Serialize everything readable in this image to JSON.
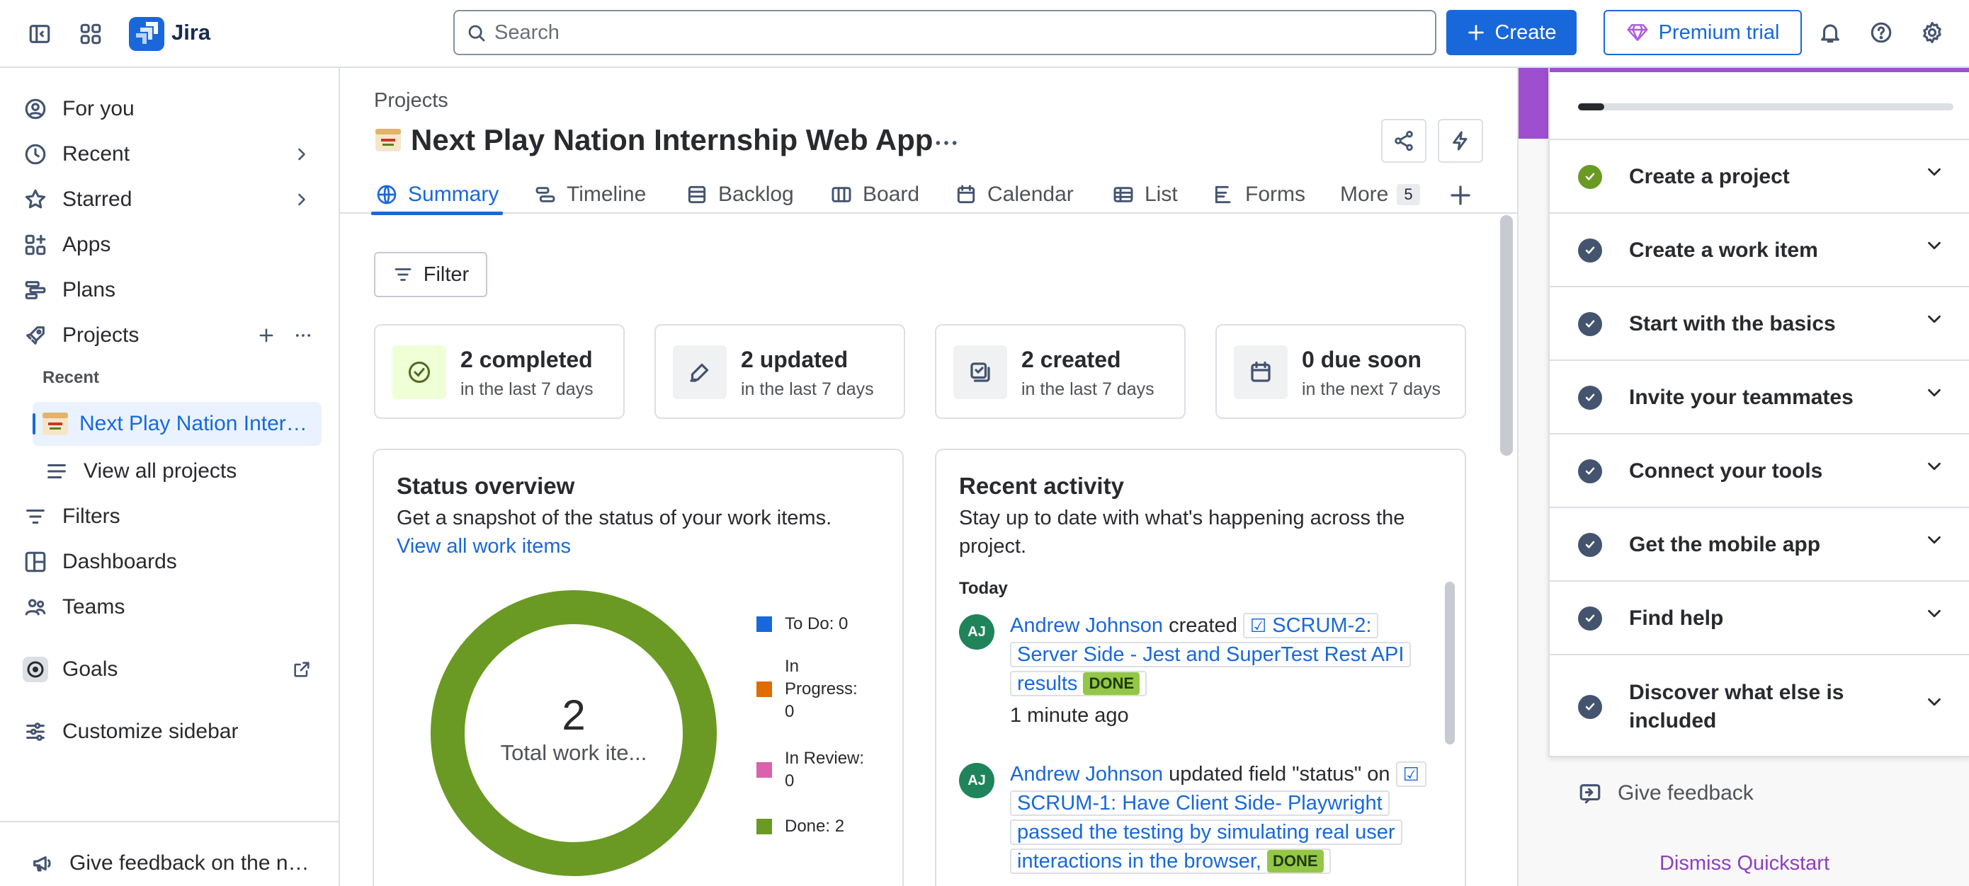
{
  "app": {
    "name": "Jira"
  },
  "topbar": {
    "search_placeholder": "Search",
    "create_label": "Create",
    "premium_label": "Premium trial"
  },
  "sidebar": {
    "items": [
      {
        "label": "For you",
        "icon": "user-circle-icon"
      },
      {
        "label": "Recent",
        "icon": "clock-icon"
      },
      {
        "label": "Starred",
        "icon": "star-icon"
      },
      {
        "label": "Apps",
        "icon": "apps-icon"
      },
      {
        "label": "Plans",
        "icon": "plans-icon"
      },
      {
        "label": "Projects",
        "icon": "rocket-icon"
      }
    ],
    "recent_heading": "Recent",
    "recent_project": "Next Play Nation Internship Web App",
    "view_all_projects": "View all projects",
    "items2": [
      {
        "label": "Filters",
        "icon": "filter-icon"
      },
      {
        "label": "Dashboards",
        "icon": "dashboard-icon"
      },
      {
        "label": "Teams",
        "icon": "people-icon"
      },
      {
        "label": "Goals",
        "icon": "goal-icon"
      },
      {
        "label": "Customize sidebar",
        "icon": "customize-icon"
      }
    ],
    "feedback": "Give feedback on the new navigation"
  },
  "main": {
    "breadcrumb": "Projects",
    "title": "Next Play Nation Internship Web App",
    "tabs": [
      {
        "label": "Summary",
        "icon": "globe-icon",
        "active": true
      },
      {
        "label": "Timeline",
        "icon": "timeline-icon"
      },
      {
        "label": "Backlog",
        "icon": "backlog-icon"
      },
      {
        "label": "Board",
        "icon": "board-icon"
      },
      {
        "label": "Calendar",
        "icon": "calendar-icon"
      },
      {
        "label": "List",
        "icon": "list-icon"
      },
      {
        "label": "Forms",
        "icon": "forms-icon"
      },
      {
        "label": "More",
        "icon": "",
        "count": "5"
      }
    ],
    "filter_label": "Filter",
    "stats": [
      {
        "title": "2 completed",
        "sub": "in the last 7 days",
        "icon": "check-circle-icon"
      },
      {
        "title": "2 updated",
        "sub": "in the last 7 days",
        "icon": "edit-icon"
      },
      {
        "title": "2 created",
        "sub": "in the last 7 days",
        "icon": "created-icon"
      },
      {
        "title": "0 due soon",
        "sub": "in the next 7 days",
        "icon": "calendar-icon"
      }
    ],
    "status_overview": {
      "title": "Status overview",
      "desc": "Get a snapshot of the status of your work items.",
      "link": "View all work items",
      "total": "2",
      "total_label": "Total work ite...",
      "legend": [
        {
          "label": "To Do: 0",
          "color": "#1868DB"
        },
        {
          "label": "In Progress: 0",
          "color": "#E06C00"
        },
        {
          "label": "In Review: 0",
          "color": "#DA62AC"
        },
        {
          "label": "Done: 2",
          "color": "#6A9A23"
        }
      ]
    },
    "recent_activity": {
      "title": "Recent activity",
      "desc": "Stay up to date with what's happening across the project.",
      "day": "Today",
      "entries": [
        {
          "initials": "AJ",
          "user": "Andrew Johnson",
          "action": "created",
          "item": "SCRUM-2: Server Side - Jest and SuperTest Rest API results",
          "status": "DONE",
          "time": "1 minute ago"
        },
        {
          "initials": "AJ",
          "user": "Andrew Johnson",
          "action": "updated field \"status\" on",
          "item": "SCRUM-1: Have Client Side- Playwright passed the  testing by simulating real user interactions in the browser,",
          "status": "DONE"
        }
      ]
    }
  },
  "quickstart": {
    "progress": 0.07,
    "items": [
      {
        "label": "Create a project",
        "done": true
      },
      {
        "label": "Create a work item",
        "done": false
      },
      {
        "label": "Start with the basics",
        "done": false
      },
      {
        "label": "Invite your teammates",
        "done": false
      },
      {
        "label": "Connect your tools",
        "done": false
      },
      {
        "label": "Get the mobile app",
        "done": false
      },
      {
        "label": "Find help",
        "done": false
      },
      {
        "label": "Discover what else is included",
        "done": false
      }
    ],
    "feedback": "Give feedback",
    "dismiss": "Dismiss Quickstart"
  }
}
